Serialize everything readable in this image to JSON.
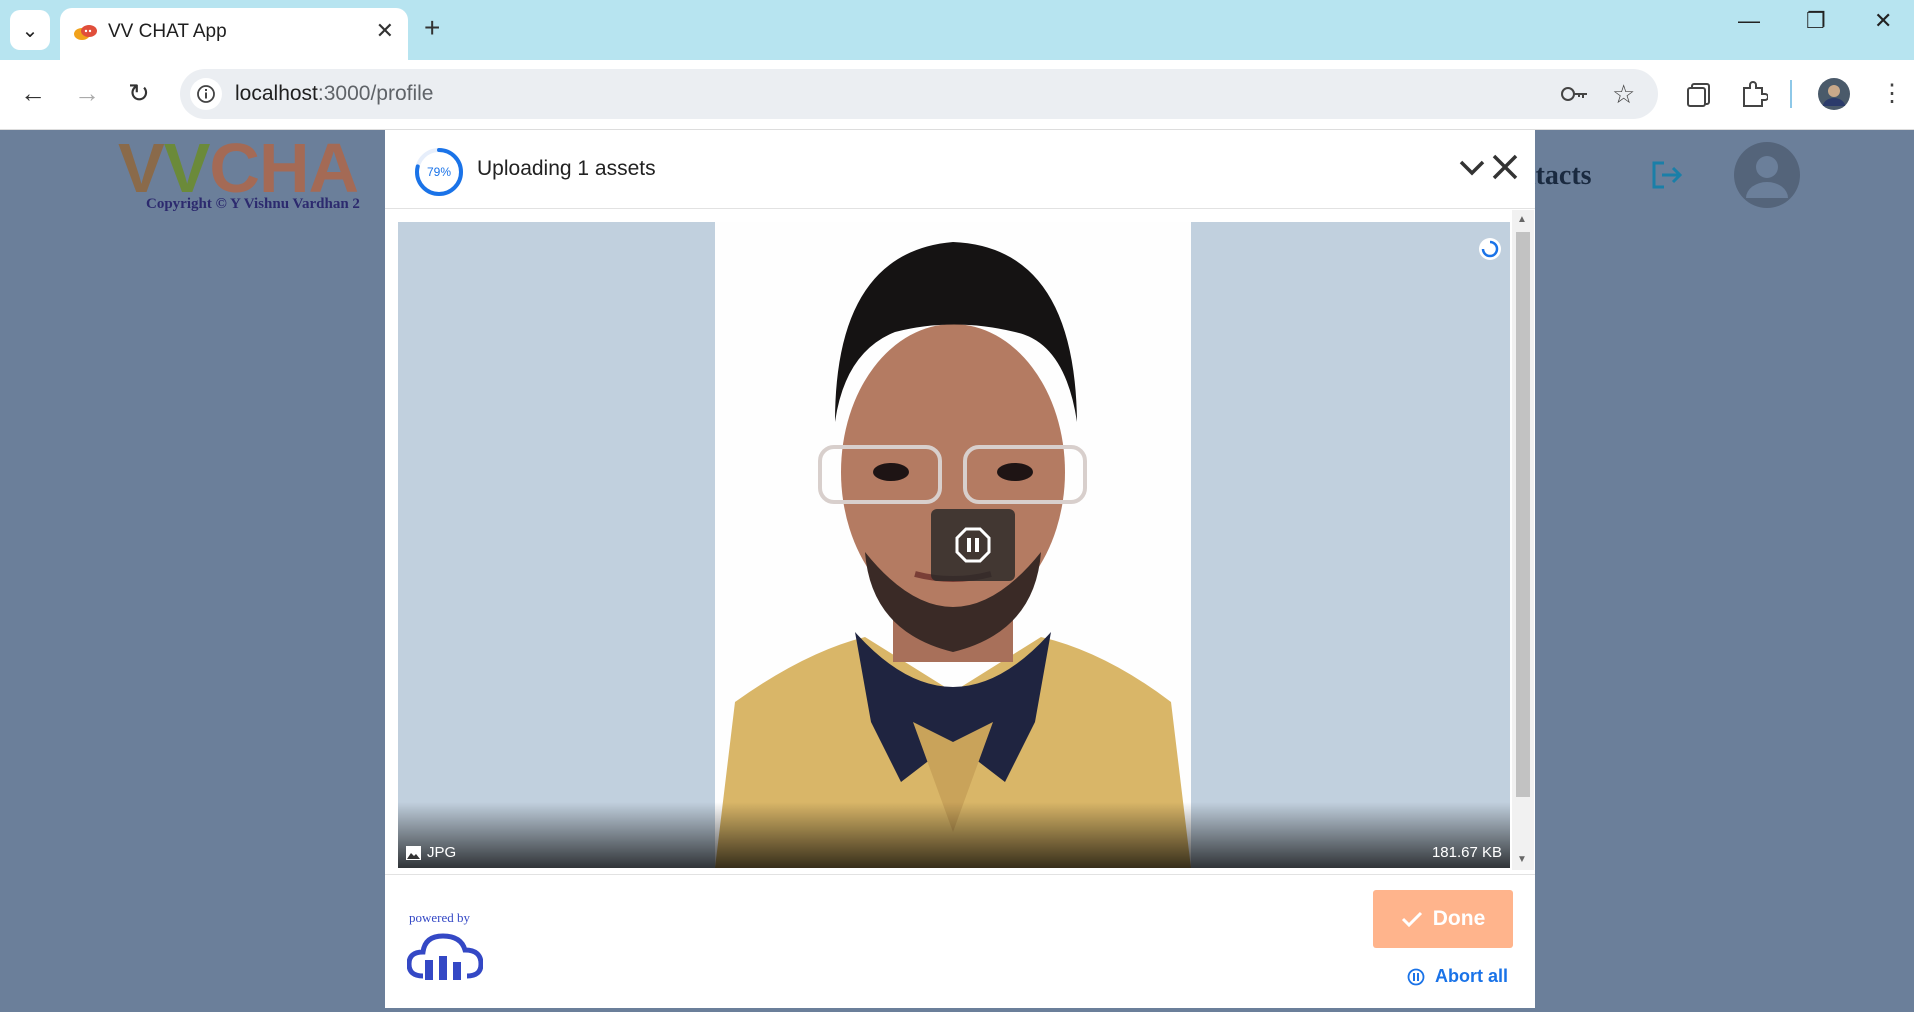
{
  "browser": {
    "tab_title": "VV CHAT App",
    "url_host": "localhost",
    "url_path": ":3000/profile"
  },
  "page": {
    "logo_text": "VVCHA",
    "copyright": "Copyright © Y Vishnu Vardhan 2",
    "nav_partial": "ntacts"
  },
  "upload": {
    "progress_percent": 79,
    "progress_label": "79%",
    "title": "Uploading 1 assets",
    "file_type": "JPG",
    "file_size": "181.67 KB",
    "done_label": "Done",
    "abort_label": "Abort all",
    "powered_by": "powered by"
  },
  "colors": {
    "accent": "#1a73e8",
    "done_button": "#ffb48c",
    "overlay_backdrop": "#6b7f9a",
    "preview_background": "#c1d0de"
  },
  "icons": [
    "search-tabs-icon",
    "back-icon",
    "forward-icon",
    "reload-icon",
    "site-info-icon",
    "key-icon",
    "star-icon",
    "reading-list-icon",
    "extensions-icon",
    "profile-avatar-icon",
    "menu-icon",
    "chevron-down-icon",
    "close-icon",
    "pause-icon",
    "image-icon",
    "check-icon",
    "cloud-logo-icon"
  ]
}
